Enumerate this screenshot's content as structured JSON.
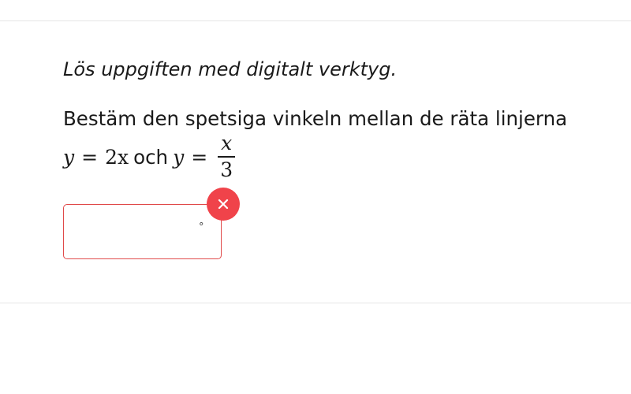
{
  "task": {
    "instruction": "Lös uppgiften med digitalt verktyg.",
    "question": "Bestäm den spetsiga vinkeln mellan de räta linjerna",
    "equation": {
      "lhs1": "y",
      "eq1": "=",
      "rhs1": "2x",
      "connector": "och",
      "lhs2": "y",
      "eq2": "=",
      "frac_num": "x",
      "frac_den": "3"
    }
  },
  "answer": {
    "value": "",
    "placeholder": "",
    "unit": "°",
    "status": "incorrect"
  },
  "colors": {
    "error": "#f0434a",
    "border_error": "#e04a4a",
    "text": "#1a1a1a",
    "divider": "#e6e6e6"
  },
  "icons": {
    "error_badge": "close-icon"
  }
}
